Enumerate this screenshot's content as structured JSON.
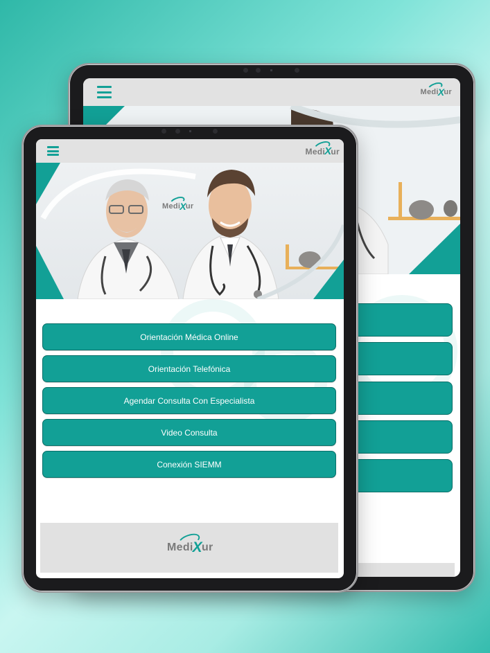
{
  "app": {
    "brand_prefix": "Medi",
    "brand_x": "X",
    "brand_suffix": "ur"
  },
  "colors": {
    "accent": "#12a096",
    "header_bg": "#e2e2e2",
    "footer_bg": "#e1e1e1",
    "logo_text": "#7a7a7a"
  },
  "icons": {
    "menu": "hamburger-menu-icon"
  },
  "menu": {
    "items": [
      {
        "label": "Orientación Médica Online"
      },
      {
        "label": "Orientación Telefónica"
      },
      {
        "label": "Agendar Consulta Con Especialista"
      },
      {
        "label": "Video Consulta"
      },
      {
        "label": "Conexión SIEMM"
      }
    ]
  }
}
